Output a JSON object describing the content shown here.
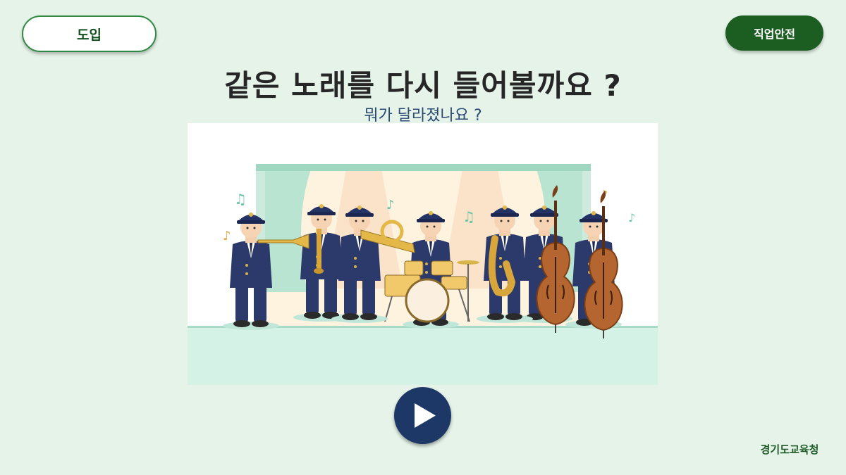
{
  "header": {
    "intro_button_label": "도입",
    "topic_button_label": "직업안전"
  },
  "main": {
    "title": "같은 노래를 다시 들어볼까요 ?",
    "subtitle": "뭐가 달라졌나요 ?"
  },
  "illustration": {
    "subject": "police-band-on-stage",
    "musicians": [
      "trumpet",
      "clarinet",
      "trombone",
      "drums",
      "saxophone",
      "double-bass",
      "double-bass"
    ]
  },
  "controls": {
    "play_icon": "play-icon"
  },
  "footer": {
    "organization": "경기도교육청"
  },
  "colors": {
    "background": "#e5f3e9",
    "accent_green": "#1c5e22",
    "play_button": "#1d3866",
    "uniform": "#2b3a6b"
  }
}
